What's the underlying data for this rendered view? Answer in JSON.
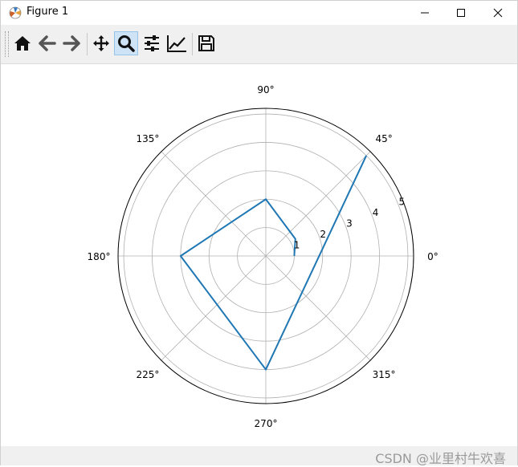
{
  "window": {
    "title": "Figure 1",
    "icon": "matplotlib-icon",
    "controls": [
      "minimize-icon",
      "maximize-icon",
      "close-icon"
    ]
  },
  "toolbar": {
    "buttons": [
      {
        "name": "home-icon",
        "active": false
      },
      {
        "name": "back-arrow-icon",
        "active": false
      },
      {
        "name": "forward-arrow-icon",
        "active": false
      },
      {
        "name": "pan-icon",
        "active": false
      },
      {
        "name": "zoom-icon",
        "active": true
      },
      {
        "name": "subplots-config-icon",
        "active": false
      },
      {
        "name": "edit-axis-icon",
        "active": false
      },
      {
        "name": "save-icon",
        "active": false
      }
    ]
  },
  "chart_data": {
    "type": "polar-line",
    "theta_deg": [
      0,
      30,
      90,
      180,
      270,
      45
    ],
    "r": [
      1,
      1.2,
      2,
      3,
      4,
      5
    ],
    "rlim": [
      0,
      5.2
    ],
    "r_ticks": [
      "1",
      "2",
      "3",
      "4",
      "5"
    ],
    "r_tick_values": [
      1,
      2,
      3,
      4,
      5
    ],
    "r_label_angle_deg": 22.5,
    "theta_ticks": [
      "0°",
      "45°",
      "90°",
      "135°",
      "180°",
      "225°",
      "270°",
      "315°"
    ],
    "theta_tick_values": [
      0,
      45,
      90,
      135,
      180,
      225,
      270,
      315
    ],
    "grid": true,
    "line_color": "#1f77b4"
  },
  "statusbar": {
    "watermark": "CSDN @业里村牛欢喜"
  }
}
